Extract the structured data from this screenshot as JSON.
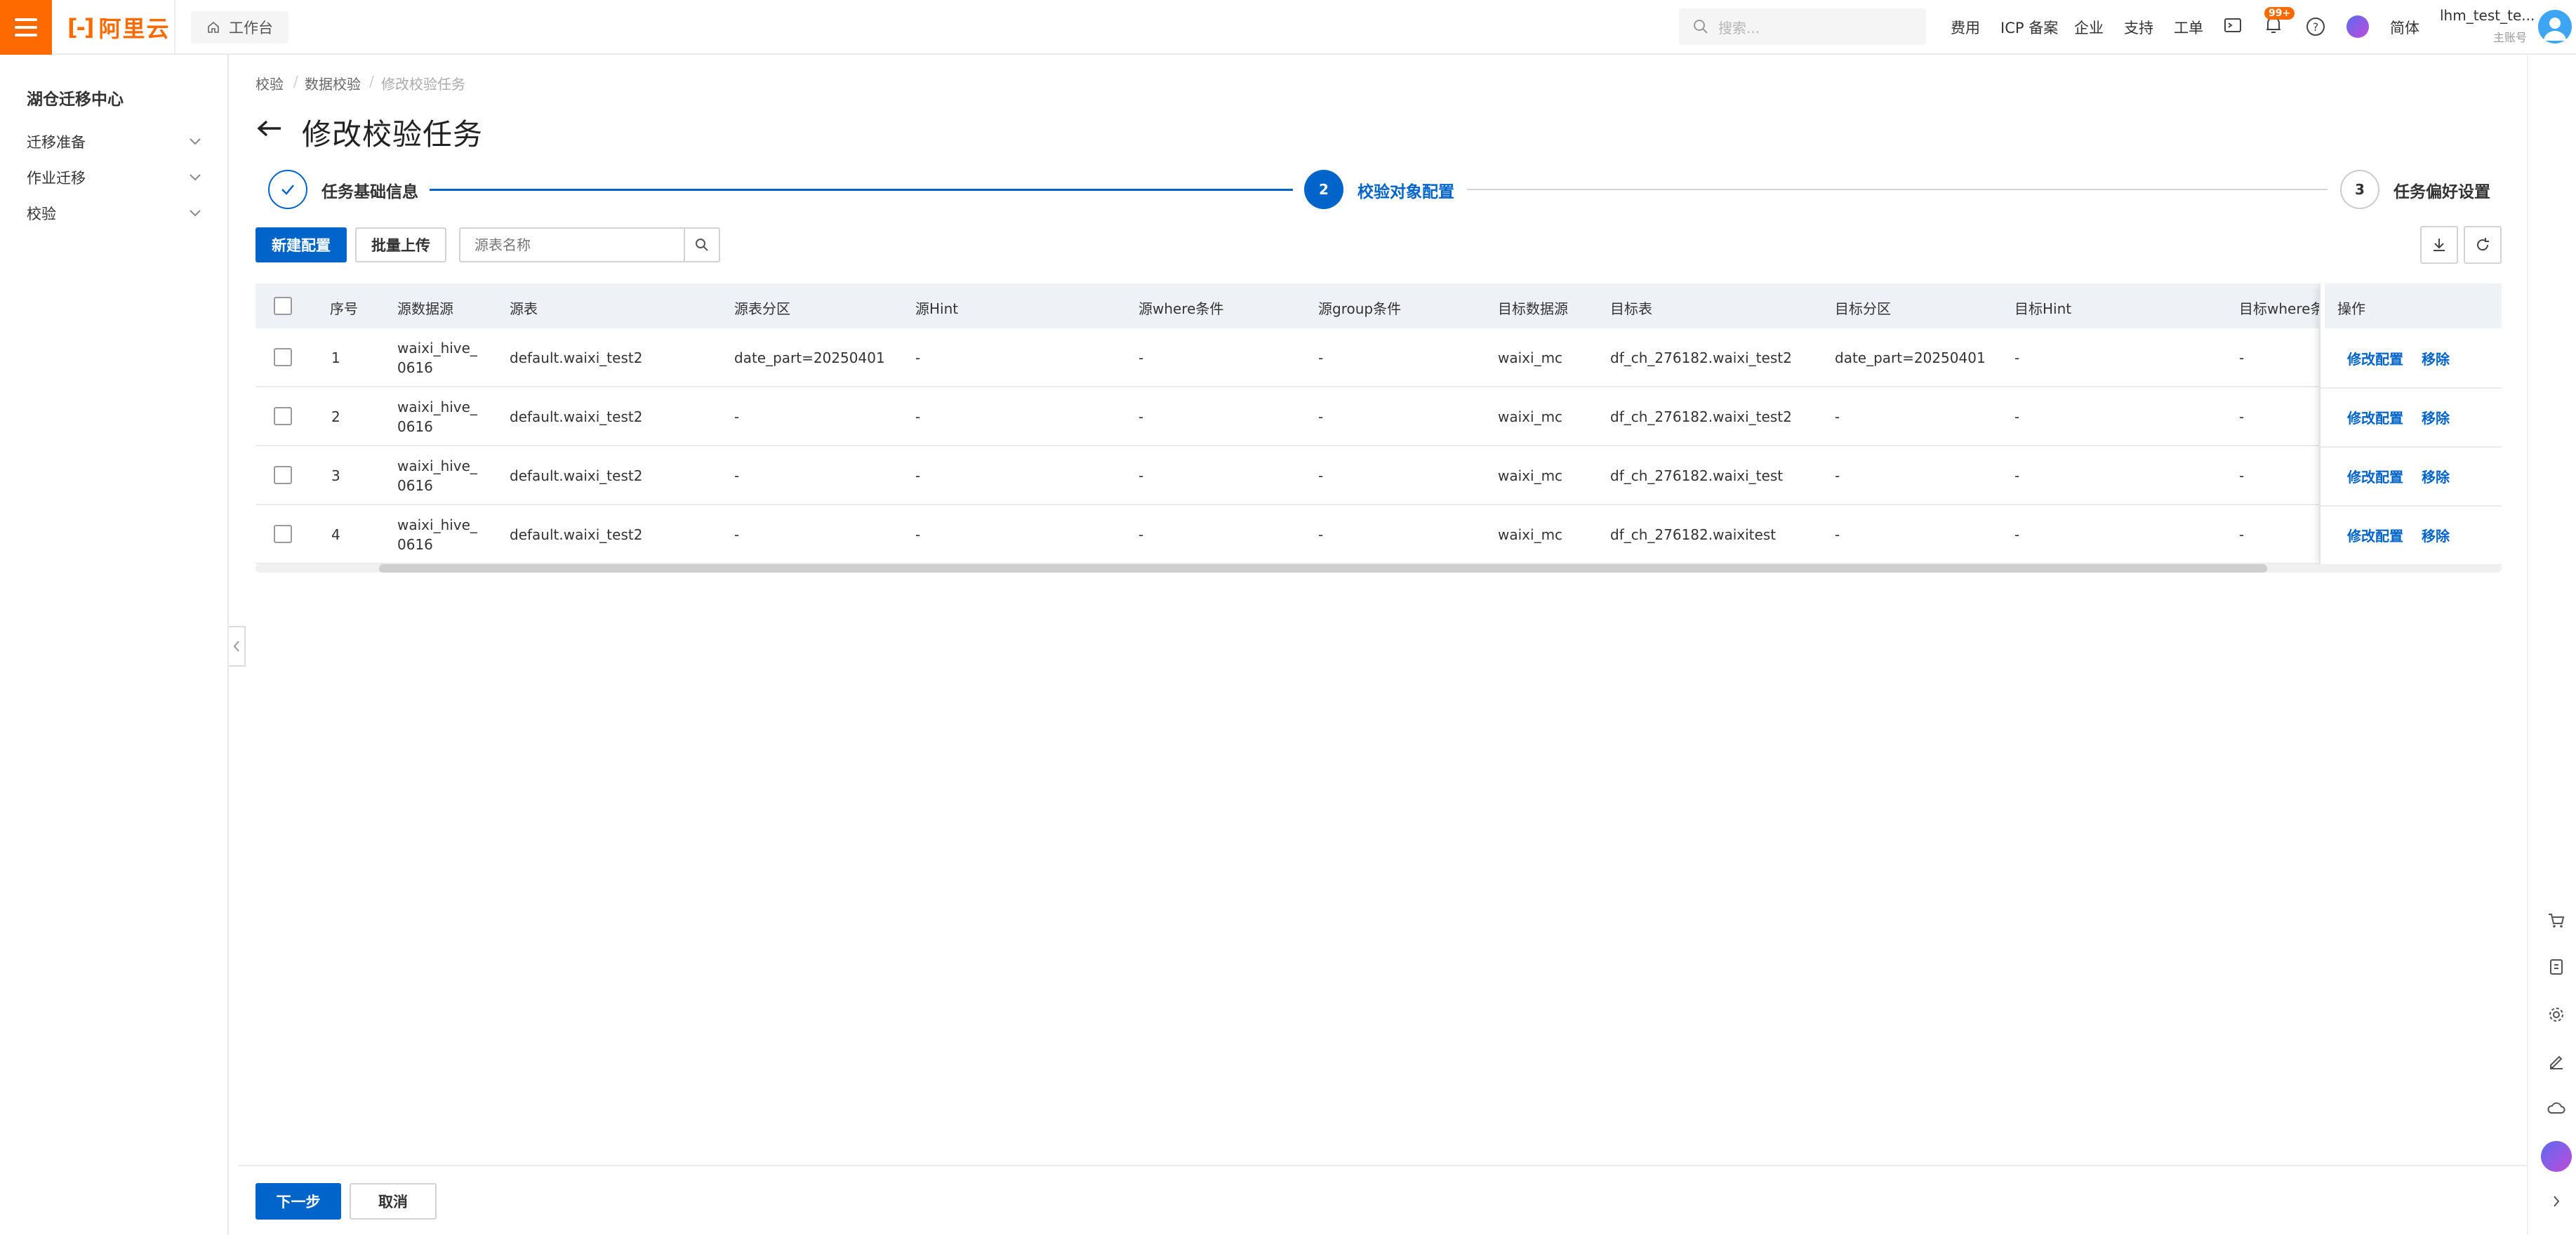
{
  "topbar": {
    "logo_mark": "[-]",
    "logo_text": "阿里云",
    "workbench": "工作台",
    "search_placeholder": "搜索...",
    "nav": [
      "费用",
      "ICP 备案",
      "企业",
      "支持",
      "工单"
    ],
    "badge": "99+",
    "lang": "简体",
    "user_name": "lhm_test_te...",
    "user_role": "主账号"
  },
  "sidebar": {
    "title": "湖仓迁移中心",
    "items": [
      "迁移准备",
      "作业迁移",
      "校验"
    ]
  },
  "breadcrumb": [
    "校验",
    "数据校验",
    "修改校验任务"
  ],
  "page_title": "修改校验任务",
  "steps": [
    {
      "num": "",
      "label": "任务基础信息",
      "status": "done"
    },
    {
      "num": "2",
      "label": "校验对象配置",
      "status": "active"
    },
    {
      "num": "3",
      "label": "任务偏好设置",
      "status": "pending"
    }
  ],
  "toolbar": {
    "new_label": "新建配置",
    "bulk_label": "批量上传",
    "search_placeholder": "源表名称"
  },
  "table": {
    "columns": [
      "序号",
      "源数据源",
      "源表",
      "源表分区",
      "源Hint",
      "源where条件",
      "源group条件",
      "目标数据源",
      "目标表",
      "目标分区",
      "目标Hint",
      "目标where条件",
      "操作"
    ],
    "rows": [
      {
        "no": "1",
        "src_ds": "waixi_hive_\n0616",
        "src_table": "default.waixi_test2",
        "src_part": "date_part=20250401",
        "src_hint": "-",
        "src_where": "-",
        "src_group": "-",
        "dst_ds": "waixi_mc",
        "dst_table": "df_ch_276182.waixi_test2",
        "dst_part": "date_part=20250401",
        "dst_hint": "-",
        "dst_where": "-"
      },
      {
        "no": "2",
        "src_ds": "waixi_hive_\n0616",
        "src_table": "default.waixi_test2",
        "src_part": "-",
        "src_hint": "-",
        "src_where": "-",
        "src_group": "-",
        "dst_ds": "waixi_mc",
        "dst_table": "df_ch_276182.waixi_test2",
        "dst_part": "-",
        "dst_hint": "-",
        "dst_where": "-"
      },
      {
        "no": "3",
        "src_ds": "waixi_hive_\n0616",
        "src_table": "default.waixi_test2",
        "src_part": "-",
        "src_hint": "-",
        "src_where": "-",
        "src_group": "-",
        "dst_ds": "waixi_mc",
        "dst_table": "df_ch_276182.waixi_test",
        "dst_part": "-",
        "dst_hint": "-",
        "dst_where": "-"
      },
      {
        "no": "4",
        "src_ds": "waixi_hive_\n0616",
        "src_table": "default.waixi_test2",
        "src_part": "-",
        "src_hint": "-",
        "src_where": "-",
        "src_group": "-",
        "dst_ds": "waixi_mc",
        "dst_table": "df_ch_276182.waixitest",
        "dst_part": "-",
        "dst_hint": "-",
        "dst_where": "-"
      }
    ],
    "action_edit": "修改配置",
    "action_remove": "移除"
  },
  "footer": {
    "next_label": "下一步",
    "cancel_label": "取消"
  },
  "colors": {
    "brand_orange": "#ff6a00",
    "primary_blue": "#0064c8"
  }
}
